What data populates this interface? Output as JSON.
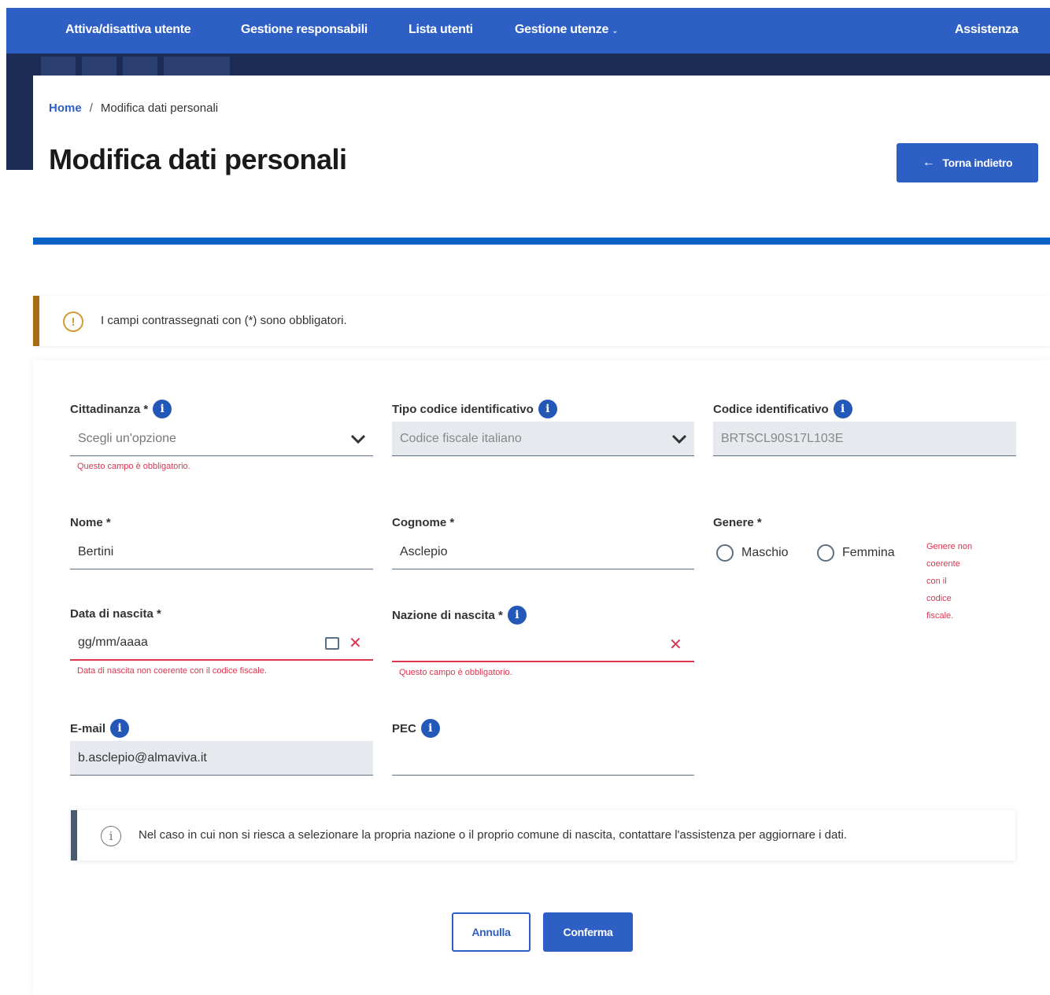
{
  "nav": {
    "items": [
      {
        "label": "Attiva/disattiva utente"
      },
      {
        "label": "Gestione responsabili"
      },
      {
        "label": "Lista utenti"
      },
      {
        "label": "Gestione utenze",
        "has_dropdown": true
      }
    ],
    "assistance": "Assistenza",
    "color": "#2e5fc4"
  },
  "breadcrumb": {
    "home": "Home",
    "separator": "/",
    "current": "Modifica dati personali"
  },
  "page": {
    "title": "Modifica dati personali",
    "back_label": "Torna indietro"
  },
  "notice": {
    "text": "I campi contrassegnati con (*) sono obbligatori.",
    "icon": "warning-icon"
  },
  "form": {
    "cittadinanza": {
      "label": "Cittadinanza *",
      "placeholder": "Scegli un'opzione",
      "error": "Questo campo è obbligatorio."
    },
    "tipo_codice": {
      "label": "Tipo codice identificativo",
      "value": "Codice fiscale italiano"
    },
    "codice": {
      "label": "Codice identificativo",
      "value": "BRTSCL90S17L103E"
    },
    "nome": {
      "label": "Nome *",
      "value": "Bertini"
    },
    "cognome": {
      "label": "Cognome *",
      "value": "Asclepio"
    },
    "genere": {
      "label": "Genere *",
      "options": [
        "Maschio",
        "Femmina"
      ],
      "error": "Genere non coerente con il codice fiscale."
    },
    "data_nascita": {
      "label": "Data di nascita *",
      "placeholder": "gg/mm/aaaa",
      "error": "Data di nascita non coerente con il codice fiscale."
    },
    "nazione_nascita": {
      "label": "Nazione di nascita *",
      "value": "",
      "error": "Questo campo è obbligatorio."
    },
    "email": {
      "label": "E-mail",
      "value": "b.asclepio@almaviva.it"
    },
    "pec": {
      "label": "PEC",
      "value": ""
    }
  },
  "infobox": {
    "text": "Nel caso in cui non si riesca a selezionare la propria nazione o il proprio comune di nascita, contattare l'assistenza per aggiornare i dati."
  },
  "actions": {
    "cancel": "Annulla",
    "confirm": "Conferma"
  },
  "colors": {
    "primary": "#2e5fc4",
    "error": "#d9364f",
    "warning": "#a86a12"
  }
}
